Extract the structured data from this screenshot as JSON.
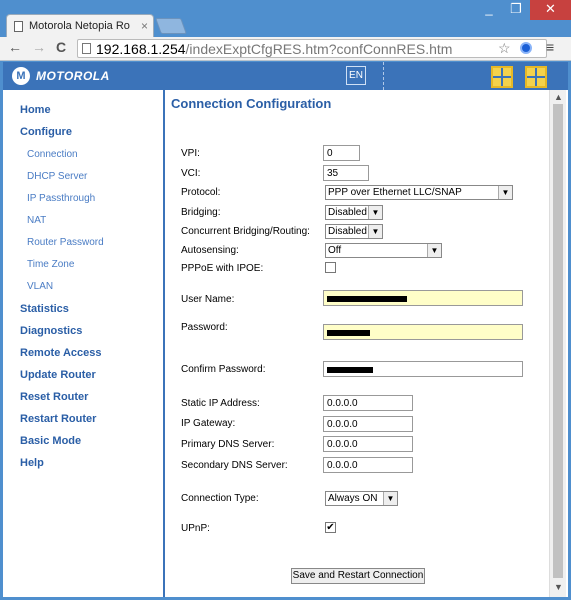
{
  "browser": {
    "tab_title": "Motorola Netopia Ro",
    "tab_close": "×",
    "url_host": "192.168.1.254",
    "url_path": "/indexExptCfgRES.htm?confConnRES.htm",
    "back": "←",
    "forward": "→",
    "reload": "C",
    "star": "☆",
    "menu": "≡",
    "minimize": "_",
    "maximize": "❐",
    "close": "✕"
  },
  "header": {
    "logo_mark": "M",
    "logo_text": "MOTOROLA",
    "lang": "EN"
  },
  "sidebar": {
    "home": "Home",
    "configure": "Configure",
    "sub": [
      "Connection",
      "DHCP Server",
      "IP Passthrough",
      "NAT",
      "Router Password",
      "Time Zone",
      "VLAN"
    ],
    "statistics": "Statistics",
    "diagnostics": "Diagnostics",
    "remote_access": "Remote Access",
    "update_router": "Update Router",
    "reset_router": "Reset Router",
    "restart_router": "Restart Router",
    "basic_mode": "Basic Mode",
    "help": "Help"
  },
  "form": {
    "title": "Connection Configuration",
    "vpi_label": "VPI:",
    "vpi_value": "0",
    "vci_label": "VCI:",
    "vci_value": "35",
    "protocol_label": "Protocol:",
    "protocol_value": "PPP over Ethernet LLC/SNAP",
    "bridging_label": "Bridging:",
    "bridging_value": "Disabled",
    "concurrent_label": "Concurrent Bridging/Routing:",
    "concurrent_value": "Disabled",
    "autosensing_label": "Autosensing:",
    "autosensing_value": "Off",
    "pppoe_ipoe_label": "PPPoE with IPOE:",
    "username_label": "User Name:",
    "password_label": "Password:",
    "confirm_password_label": "Confirm Password:",
    "static_ip_label": "Static IP Address:",
    "static_ip_value": "0.0.0.0",
    "ip_gateway_label": "IP Gateway:",
    "ip_gateway_value": "0.0.0.0",
    "primary_dns_label": "Primary DNS Server:",
    "primary_dns_value": "0.0.0.0",
    "secondary_dns_label": "Secondary DNS Server:",
    "secondary_dns_value": "0.0.0.0",
    "connection_type_label": "Connection Type:",
    "connection_type_value": "Always ON",
    "upnp_label": "UPnP:",
    "upnp_checked": "✔",
    "submit_label": "Save and Restart Connection",
    "dropdown_arrow": "▼"
  },
  "scrollbar": {
    "up": "▲",
    "down": "▼"
  },
  "colors": {
    "accent": "#3b73b9",
    "nav": "#2a5ea6",
    "input_highlight": "#fffec8"
  }
}
